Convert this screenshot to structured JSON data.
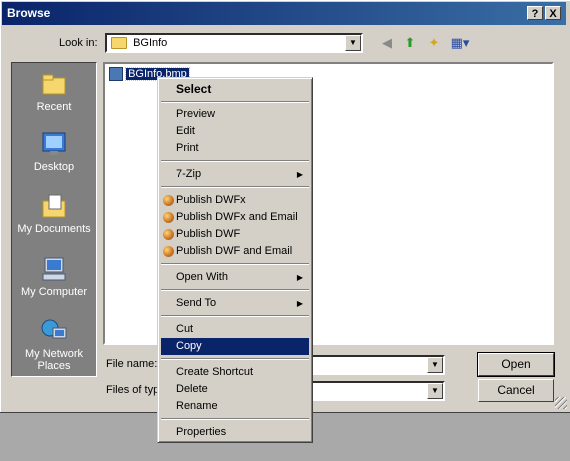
{
  "window": {
    "title": "Browse",
    "help_glyph": "?",
    "close_glyph": "X"
  },
  "lookin": {
    "label": "Look in:",
    "value": "BGInfo"
  },
  "places": [
    {
      "label": "Recent",
      "icon": "recent-folder-icon"
    },
    {
      "label": "Desktop",
      "icon": "desktop-icon"
    },
    {
      "label": "My Documents",
      "icon": "my-documents-icon"
    },
    {
      "label": "My Computer",
      "icon": "my-computer-icon"
    },
    {
      "label": "My Network Places",
      "icon": "network-places-icon"
    }
  ],
  "files": [
    {
      "name": "BGInfo.bmp",
      "icon": "bitmap-file-icon",
      "selected": true
    }
  ],
  "filename": {
    "label": "File name:",
    "value": ""
  },
  "filetype": {
    "label": "Files of typ",
    "value": ""
  },
  "buttons": {
    "open": "Open",
    "cancel": "Cancel"
  },
  "context_menu": {
    "select": "Select",
    "preview": "Preview",
    "edit": "Edit",
    "print": "Print",
    "sevenzip": "7-Zip",
    "publish_dwfx": "Publish DWFx",
    "publish_dwfx_email": "Publish DWFx and Email",
    "publish_dwf": "Publish DWF",
    "publish_dwf_email": "Publish DWF and Email",
    "open_with": "Open With",
    "send_to": "Send To",
    "cut": "Cut",
    "copy": "Copy",
    "create_shortcut": "Create Shortcut",
    "delete": "Delete",
    "rename": "Rename",
    "properties": "Properties",
    "highlighted": "Copy"
  },
  "colors": {
    "title_bar": "#0a246a",
    "selection": "#0a246a",
    "face": "#d4d0c8"
  }
}
